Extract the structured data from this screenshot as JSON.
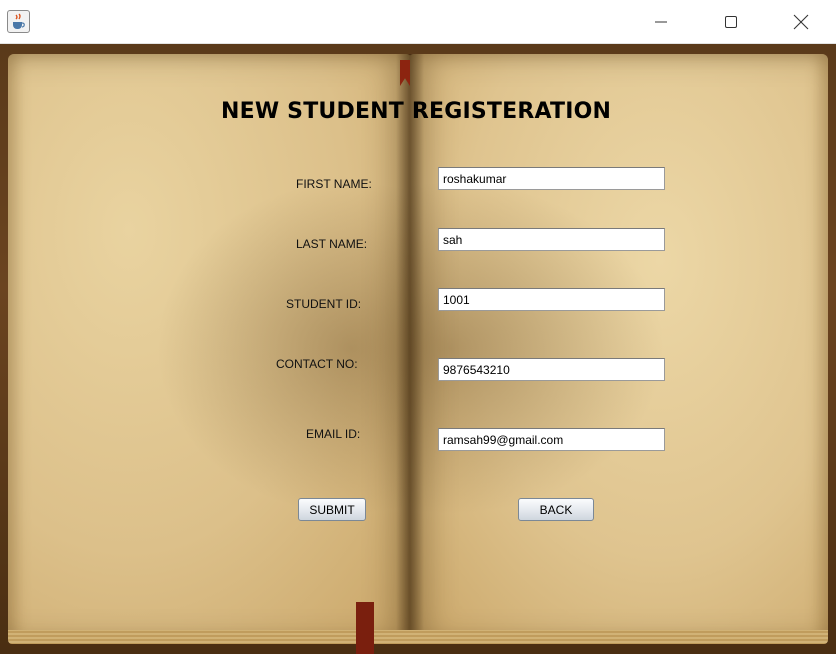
{
  "window": {
    "icon": "java-cup-icon",
    "controls": [
      "minimize-icon",
      "maximize-icon",
      "close-icon"
    ]
  },
  "form": {
    "title": "NEW STUDENT REGISTERATION",
    "fields": {
      "first_name": {
        "label": "FIRST NAME:",
        "value": "roshakumar"
      },
      "last_name": {
        "label": "LAST NAME:",
        "value": "sah"
      },
      "student_id": {
        "label": "STUDENT ID:",
        "value": "1001"
      },
      "contact_no": {
        "label": "CONTACT NO:",
        "value": "9876543210"
      },
      "email_id": {
        "label": "EMAIL ID:",
        "value": "ramsah99@gmail.com"
      }
    },
    "buttons": {
      "submit": "SUBMIT",
      "back": "BACK"
    }
  }
}
